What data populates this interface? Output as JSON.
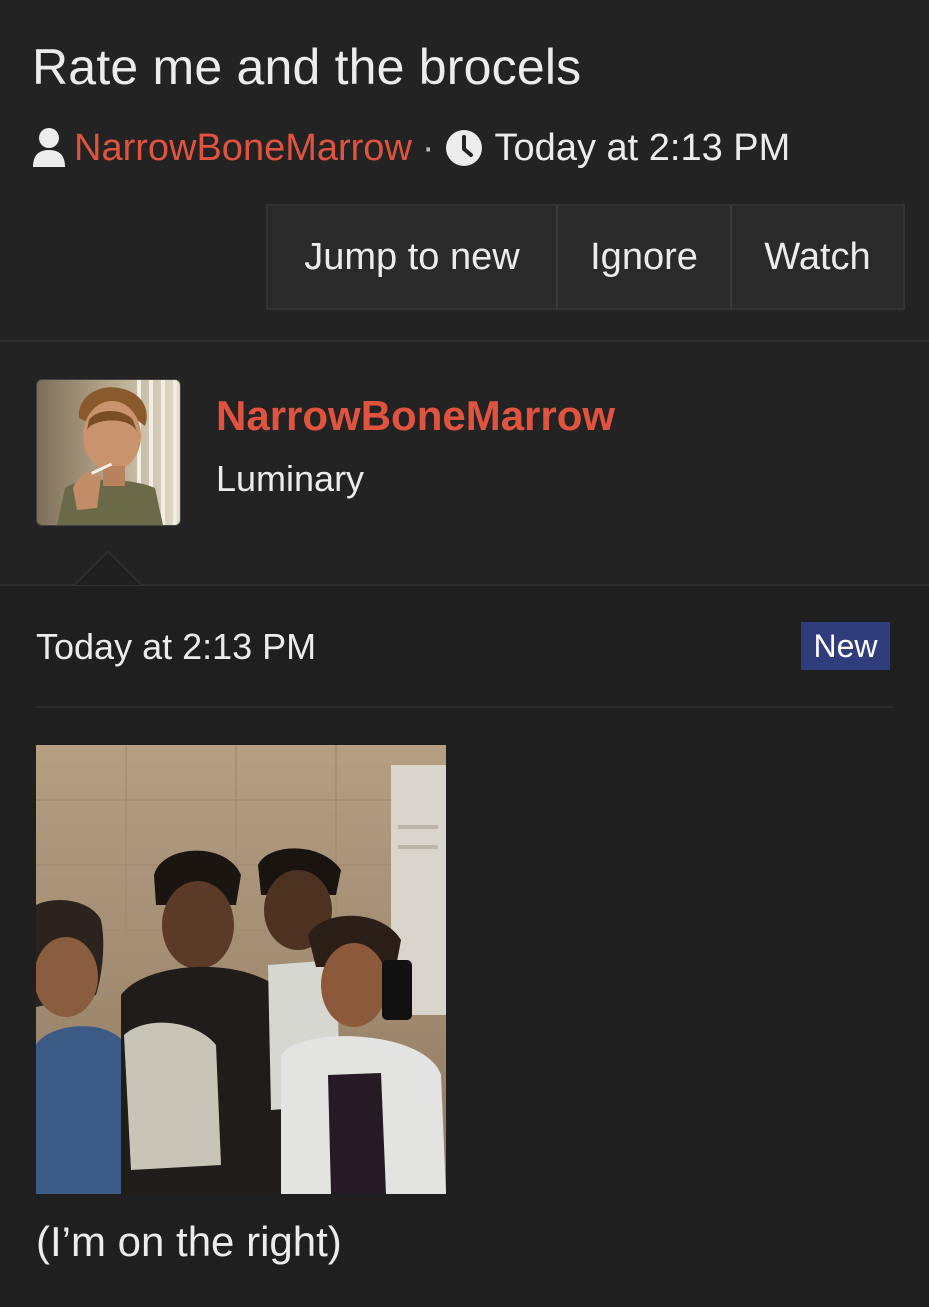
{
  "thread": {
    "title": "Rate me and the brocels",
    "author": "NarrowBoneMarrow",
    "separator": "·",
    "date": "Today at 2:13 PM"
  },
  "actions": {
    "jump_label": "Jump to new",
    "ignore_label": "Ignore",
    "watch_label": "Watch"
  },
  "post": {
    "username": "NarrowBoneMarrow",
    "user_title": "Luminary",
    "date": "Today at 2:13 PM",
    "badge": "New",
    "caption": "(I’m on the right)"
  },
  "icons": {
    "user": "user-icon",
    "clock": "clock-icon"
  },
  "colors": {
    "background": "#1f1f1f",
    "header_background": "#232323",
    "accent_username": "#e0543f",
    "badge_background": "#2f3d7c"
  }
}
